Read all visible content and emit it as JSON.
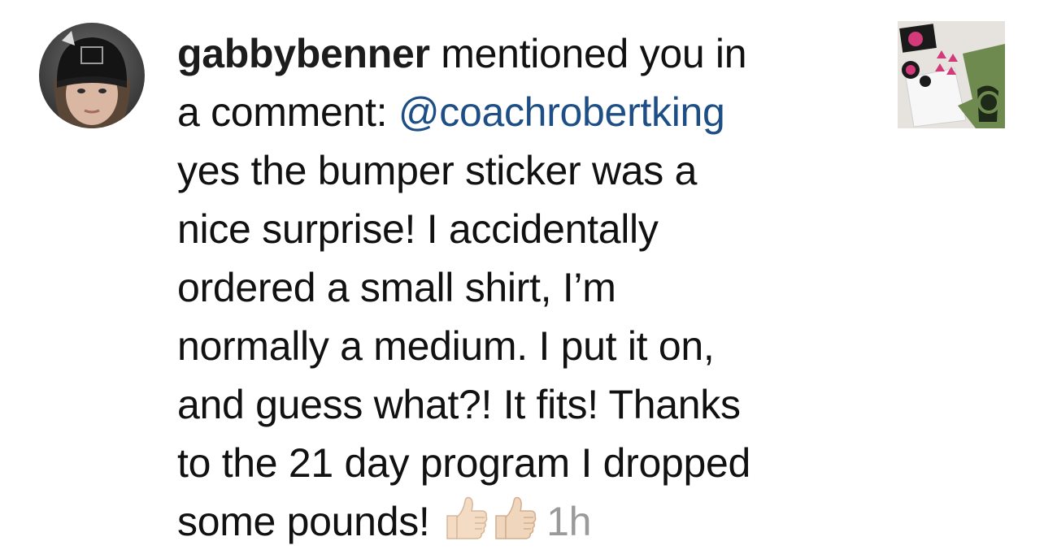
{
  "notification": {
    "username": "gabbybenner",
    "action_line1": " mentioned you in",
    "action_line2": "a comment: ",
    "mention": "@coachrobertking",
    "comment_lines": [
      "yes the bumper sticker was a",
      "nice surprise! I accidentally",
      "ordered a small shirt, I’m",
      "normally a medium. I put it on,",
      "and guess what?! It fits! Thanks",
      "to the 21 day program I dropped",
      "some pounds! "
    ],
    "timestamp": "1h",
    "emojis": [
      "thumbs-up-light-skin-icon",
      "thumbs-up-light-skin-icon"
    ]
  },
  "colors": {
    "text": "#111111",
    "mention": "#1d4f86",
    "timestamp": "#9a9a9a"
  }
}
